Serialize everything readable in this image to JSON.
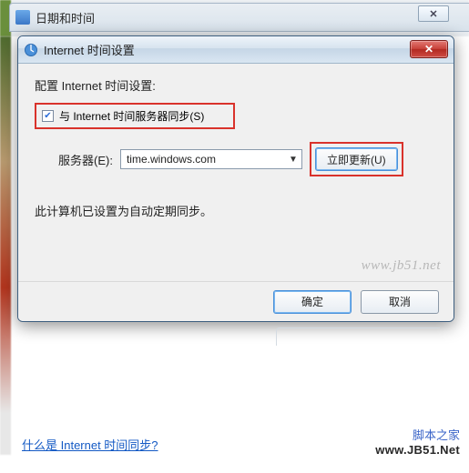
{
  "parent_window": {
    "title": "日期和时间",
    "minimize_glyph": "✕"
  },
  "dialog": {
    "title": "Internet 时间设置",
    "close_glyph": "✕",
    "heading": "配置 Internet 时间设置:",
    "sync_checkbox": {
      "checked_glyph": "✔",
      "label": "与 Internet 时间服务器同步(S)"
    },
    "server_label": "服务器(E):",
    "server_value": "time.windows.com",
    "update_button": "立即更新(U)",
    "status_text": "此计算机已设置为自动定期同步。",
    "watermark": "www.jb51.net",
    "ok_button": "确定",
    "cancel_button": "取消"
  },
  "help_link": "什么是 Internet 时间同步?",
  "footer": {
    "site_zh": "脚本之家",
    "site_en": "www.JB51.Net"
  }
}
